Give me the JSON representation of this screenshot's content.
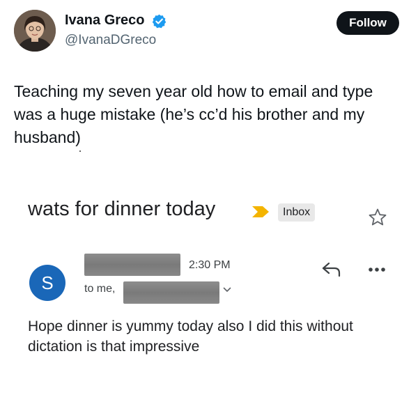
{
  "tweet": {
    "author": {
      "display_name": "Ivana Greco",
      "handle": "@IvanaDGreco",
      "verified": true
    },
    "follow_label": "Follow",
    "text": "Teaching my seven year old how to email and type was a huge mistake (he’s cc’d his brother and my husband)"
  },
  "email": {
    "subject": "wats for dinner today",
    "label": "Inbox",
    "sender_initial": "S",
    "sender_name": "[redacted]",
    "time": "2:30 PM",
    "to_prefix": "to me,",
    "recipient": "[redacted]",
    "body": "Hope dinner is yummy today also I did this without dictation is that impressive",
    "icons": {
      "importance": "importance-marker-icon",
      "star": "star-icon",
      "reply": "reply-icon",
      "more": "more-options-icon",
      "expand": "chevron-down-icon"
    }
  },
  "colors": {
    "follow_button_bg": "#0f1419",
    "verified_badge": "#1d9bf0",
    "importance_marker": "#f4b400",
    "sender_avatar_bg": "#1a67b8",
    "secondary_text": "#536471"
  }
}
